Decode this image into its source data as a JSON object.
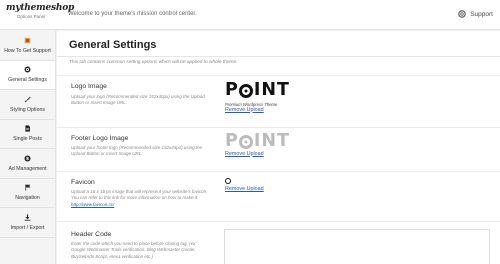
{
  "header": {
    "logo_main": "mythemeshop",
    "logo_sub": "Options Panel",
    "welcome": "Welcome to your theme's mission control center.",
    "support_label": "Support"
  },
  "sidebar": {
    "items": [
      {
        "label": "How To Get Support",
        "icon": "support-badge-icon"
      },
      {
        "label": "General Settings",
        "icon": "gear-icon"
      },
      {
        "label": "Styling Options",
        "icon": "brush-icon"
      },
      {
        "label": "Single Posts",
        "icon": "document-icon"
      },
      {
        "label": "Ad Management",
        "icon": "money-icon"
      },
      {
        "label": "Navigation",
        "icon": "flag-icon"
      },
      {
        "label": "Import / Export",
        "icon": "download-icon"
      }
    ],
    "active_index": 1
  },
  "main": {
    "title": "General Settings",
    "intro": "This tab contains common setting options which will be applied to whole theme.",
    "logo_section": {
      "title": "Logo Image",
      "desc": "Upload your logo (Recommended size 152x40px) using the Upload Button or Insert Image URL.",
      "preview_text": "POINT",
      "preview_tagline": "Premium Wordpress Theme",
      "remove": "Remove Upload"
    },
    "footer_logo_section": {
      "title": "Footer Logo Image",
      "desc": "Upload your footer logo (Recommended size 152x43px) using the Upload Button or Insert Image URL.",
      "preview_text": "POINT",
      "remove": "Remove Upload"
    },
    "favicon_section": {
      "title": "Favicon",
      "desc": "Upload a 16 x 16 px image that will represent your website's favicon. You can refer to this link for more information on how to make it:",
      "link": "http://www.favicon.cc/",
      "remove": "Remove Upload"
    },
    "header_code_section": {
      "title": "Header Code",
      "desc": "Enter the code which you need to place before closing tag. (ex: Google Webmaster Tools verification, Bing Webmaster Center, BuySellAds Script, Alexa verification etc.)"
    }
  },
  "colors": {
    "accent_link": "#2a5db0",
    "active_nav_bg": "#ffffff",
    "sidebar_bg": "#f4f4f4",
    "support_icon": "#e0a22a"
  }
}
